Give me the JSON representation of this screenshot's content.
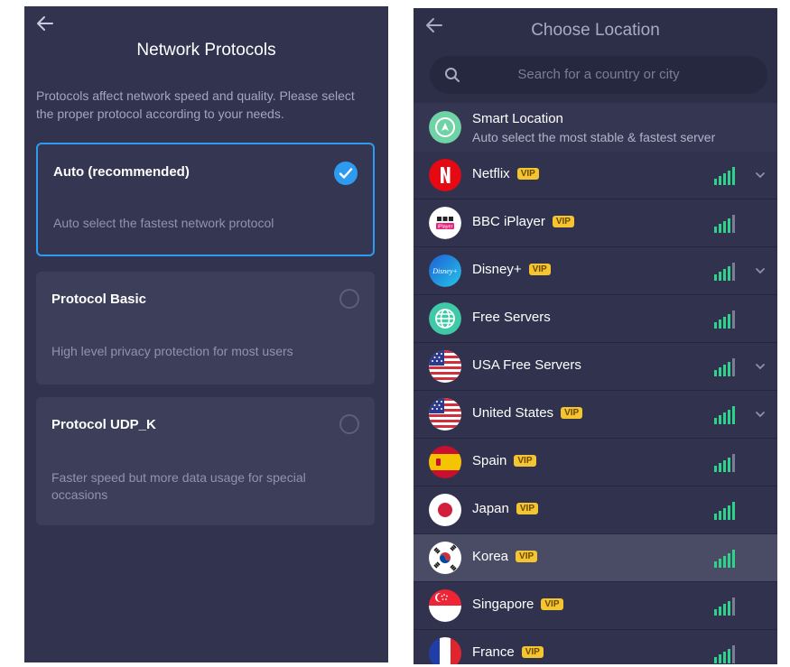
{
  "left_panel": {
    "title": "Network Protocols",
    "description": "Protocols affect network speed and quality. Please select the proper protocol according to your needs.",
    "options": [
      {
        "name": "Auto (recommended)",
        "description": "Auto select the fastest network protocol",
        "selected": true
      },
      {
        "name": "Protocol Basic",
        "description": "High level privacy protection for most users",
        "selected": false
      },
      {
        "name": "Protocol UDP_K",
        "description": "Faster speed but more data usage for special occasions",
        "selected": false
      }
    ]
  },
  "right_panel": {
    "title": "Choose Location",
    "search_placeholder": "Search for a country or city",
    "smart_location": {
      "name": "Smart Location",
      "subtitle": "Auto select the most stable & fastest server"
    },
    "vip_label": "VIP",
    "locations": [
      {
        "name": "Netflix",
        "vip": true,
        "expandable": true,
        "icon": "netflix-icon"
      },
      {
        "name": "BBC iPlayer",
        "vip": true,
        "expandable": false,
        "icon": "bbc-iplayer-icon"
      },
      {
        "name": "Disney+",
        "vip": true,
        "expandable": true,
        "icon": "disney-plus-icon"
      },
      {
        "name": "Free Servers",
        "vip": false,
        "expandable": false,
        "icon": "globe-icon"
      },
      {
        "name": "USA Free Servers",
        "vip": false,
        "expandable": true,
        "icon": "usa-flag-icon"
      },
      {
        "name": "United States",
        "vip": true,
        "expandable": true,
        "icon": "usa-flag-icon"
      },
      {
        "name": "Spain",
        "vip": true,
        "expandable": false,
        "icon": "spain-flag-icon"
      },
      {
        "name": "Japan",
        "vip": true,
        "expandable": false,
        "icon": "japan-flag-icon"
      },
      {
        "name": "Korea",
        "vip": true,
        "expandable": false,
        "icon": "korea-flag-icon",
        "highlighted": true
      },
      {
        "name": "Singapore",
        "vip": true,
        "expandable": false,
        "icon": "singapore-flag-icon"
      },
      {
        "name": "France",
        "vip": true,
        "expandable": false,
        "icon": "france-flag-icon"
      }
    ]
  },
  "colors": {
    "accent": "#2d9cf0",
    "signal": "#2fd28a",
    "vip": "#f5c431",
    "panel": "#32344f"
  }
}
